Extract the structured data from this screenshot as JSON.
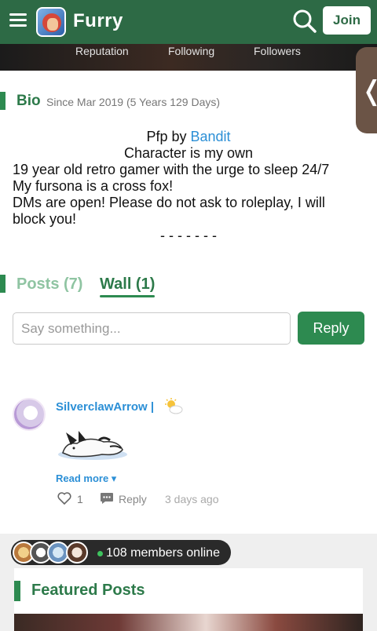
{
  "header": {
    "app_name": "Furry",
    "join_label": "Join"
  },
  "stats": {
    "reputation": "Reputation",
    "following": "Following",
    "followers": "Followers"
  },
  "bio": {
    "title": "Bio",
    "since": "Since Mar 2019 (5 Years 129 Days)",
    "pfp_prefix": "Pfp by ",
    "pfp_link": "Bandit",
    "line2": "Character is my own",
    "line3": "19 year old retro gamer with the urge to sleep 24/7",
    "line4": "My fursona is a cross fox!",
    "line5": "DMs are open! Please do not ask to roleplay, I will",
    "line6": "block you!",
    "divider": "- - - - - - -"
  },
  "tabs": {
    "posts": "Posts (7)",
    "wall": "Wall (1)"
  },
  "composer": {
    "placeholder": "Say something...",
    "reply_label": "Reply"
  },
  "comment": {
    "author": "SilverclawArrow |",
    "read_more": "Read more ▾",
    "likes": "1",
    "reply_label": "Reply",
    "time": "3 days ago"
  },
  "online": {
    "text": "108 members online"
  },
  "featured": {
    "title": "Featured Posts"
  },
  "colors": {
    "brand_green": "#2d6a45",
    "accent_green": "#2d8a50",
    "link_blue": "#2b8fd6"
  }
}
